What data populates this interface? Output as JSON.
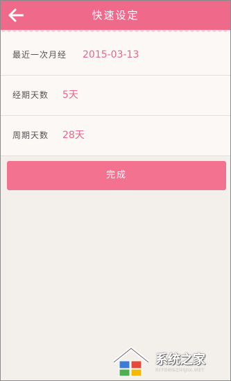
{
  "header": {
    "title": "快速设定",
    "back_icon": "arrow-left-icon"
  },
  "settings": [
    {
      "label": "最近一次月经",
      "value": "2015-03-13"
    },
    {
      "label": "经期天数",
      "value": "5天"
    },
    {
      "label": "周期天数",
      "value": "28天"
    }
  ],
  "done_button": {
    "label": "完成"
  },
  "watermark": {
    "name": "系统之家",
    "url": "XITONGZHIJIA.NET"
  },
  "colors": {
    "header": "#ef6a8a",
    "accent": "#e9658a",
    "button": "#f2728f",
    "background": "#f3efeb"
  }
}
